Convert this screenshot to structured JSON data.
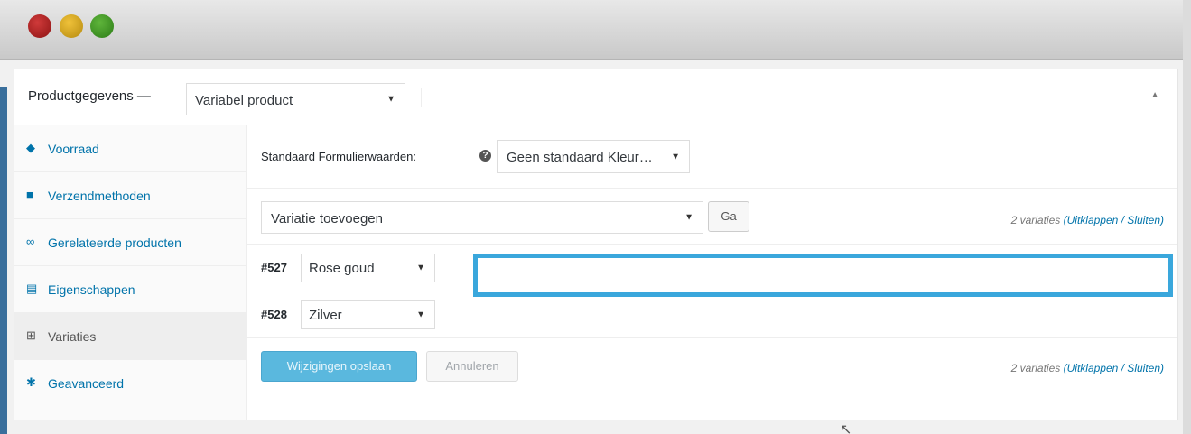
{
  "window": {
    "traffic_lights": [
      "close",
      "minimize",
      "maximize"
    ],
    "colors": {
      "close": "#b22222",
      "minimize": "#e0a92a",
      "maximize": "#45a02a"
    }
  },
  "panel": {
    "title": "Productgegevens —",
    "product_type": "Variabel product",
    "collapse_icon": "triangle-up-icon"
  },
  "sidebar": {
    "items": [
      {
        "label": "Voorraad",
        "icon": "tag-icon"
      },
      {
        "label": "Verzendmethoden",
        "icon": "truck-icon"
      },
      {
        "label": "Gerelateerde producten",
        "icon": "link-icon"
      },
      {
        "label": "Eigenschappen",
        "icon": "list-icon"
      },
      {
        "label": "Variaties",
        "icon": "grid-icon"
      },
      {
        "label": "Geavanceerd",
        "icon": "gear-icon"
      }
    ],
    "active": "Variaties"
  },
  "defaults": {
    "label": "Standaard Formulierwaarden:",
    "value": "Geen standaard Kleur…"
  },
  "add_variation": {
    "select_value": "Variatie toevoegen",
    "go_label": "Ga"
  },
  "count": {
    "prefix": "2 variaties",
    "links": "(Uitklappen / Sluiten)"
  },
  "variations": [
    {
      "id": "#527",
      "value": "Rose goud"
    },
    {
      "id": "#528",
      "value": "Zilver"
    }
  ],
  "actions": {
    "save_label": "Wijzigingen opslaan",
    "cancel_label": "Annuleren"
  },
  "accent_colors": {
    "link": "#0073aa",
    "highlight": "#3aa7dc",
    "primary": "#5ab8de"
  }
}
